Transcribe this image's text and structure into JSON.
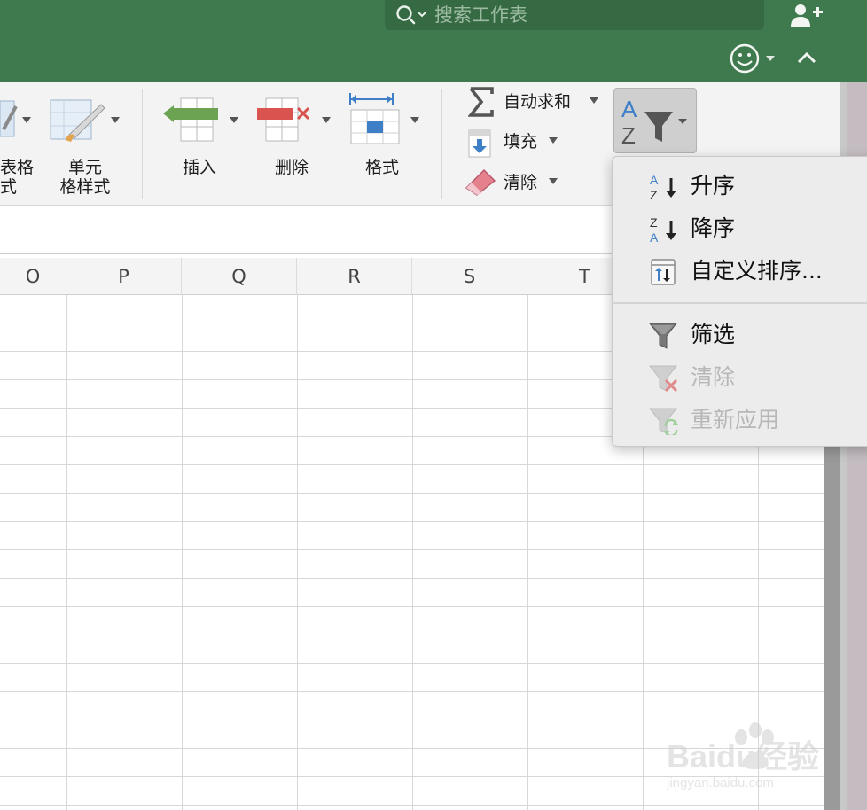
{
  "search": {
    "placeholder": "搜索工作表"
  },
  "ribbon": {
    "format_as_table_label_line1": "表格",
    "format_as_table_label_line2": "式",
    "cell_styles_label_line1": "单元",
    "cell_styles_label_line2": "格样式",
    "insert_label": "插入",
    "delete_label": "删除",
    "format_label": "格式",
    "autosum_label": "自动求和",
    "fill_label": "填充",
    "clear_label": "清除"
  },
  "columns": [
    "O",
    "P",
    "Q",
    "R",
    "S",
    "T"
  ],
  "sort_filter_menu": {
    "items": [
      {
        "label": "升序",
        "icon": "sort-ascending-icon",
        "enabled": true
      },
      {
        "label": "降序",
        "icon": "sort-descending-icon",
        "enabled": true
      },
      {
        "label": "自定义排序...",
        "icon": "custom-sort-icon",
        "enabled": true
      },
      {
        "label": "筛选",
        "icon": "filter-icon",
        "enabled": true
      },
      {
        "label": "清除",
        "icon": "clear-filter-icon",
        "enabled": false
      },
      {
        "label": "重新应用",
        "icon": "reapply-filter-icon",
        "enabled": false
      }
    ]
  },
  "colors": {
    "title_bar": "#3e7a4d",
    "ribbon_bg": "#f3f3f3",
    "menu_bg": "#ececec",
    "sort_icon_blue": "#3f7fc8"
  },
  "watermark": {
    "text": "Baidu经验",
    "url_text": "jingyan.baidu.com"
  }
}
